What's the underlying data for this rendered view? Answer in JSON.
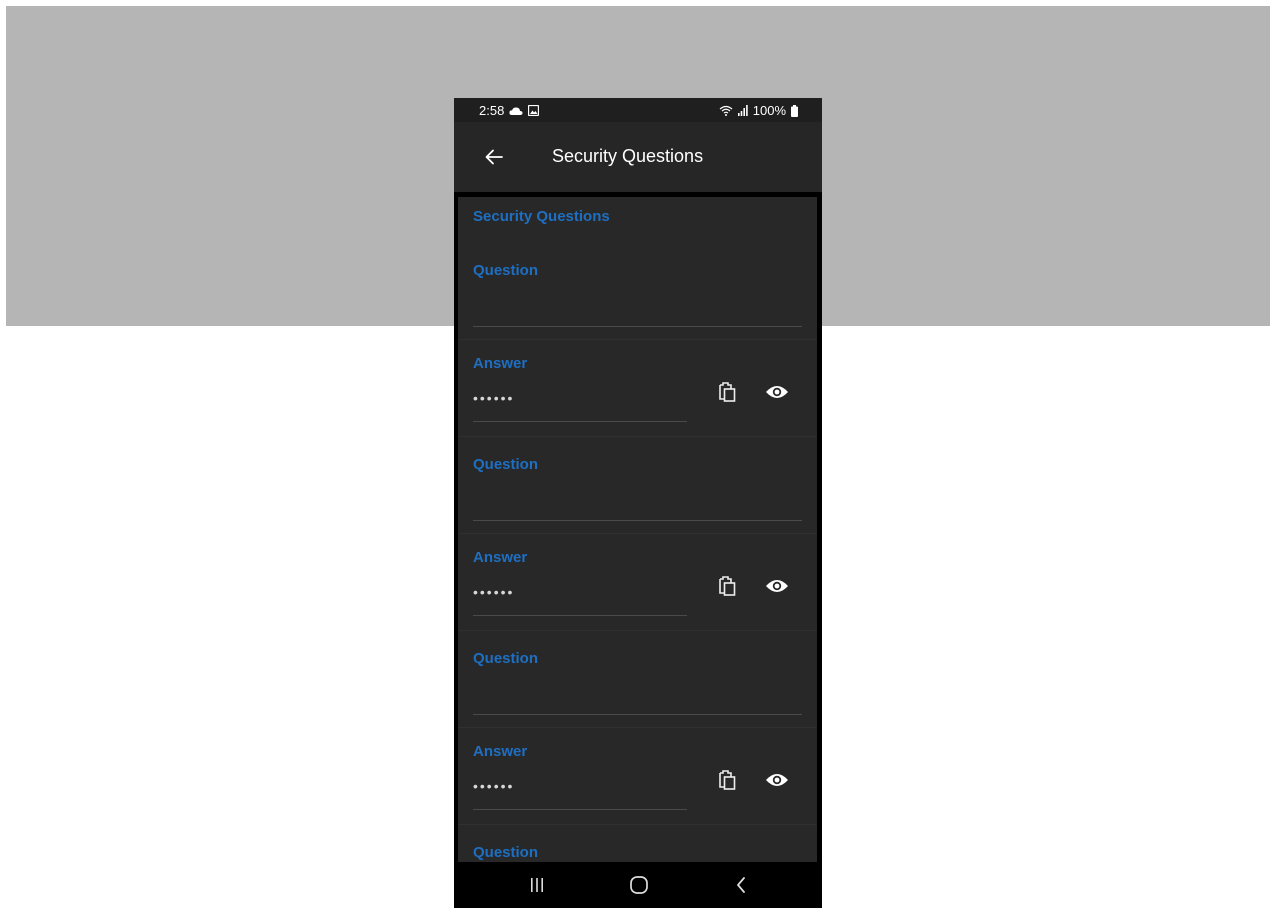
{
  "status_bar": {
    "time": "2:58",
    "battery": "100%",
    "icons": [
      "cloud-icon",
      "image-icon",
      "wifi-icon",
      "signal-icon",
      "battery-icon"
    ]
  },
  "app_bar": {
    "title": "Security Questions",
    "back_icon": "arrow-left-icon"
  },
  "card": {
    "section_title": "Security Questions",
    "rows": [
      {
        "question_label": "Question",
        "answer_label": "Answer",
        "answer_value": "••••••"
      },
      {
        "question_label": "Question",
        "answer_label": "Answer",
        "answer_value": "••••••"
      },
      {
        "question_label": "Question",
        "answer_label": "Answer",
        "answer_value": "••••••"
      },
      {
        "question_label": "Question"
      }
    ],
    "row_icons": [
      "clipboard-icon",
      "eye-icon"
    ]
  },
  "nav_bar": {
    "icons": [
      "recents-icon",
      "home-icon",
      "back-icon"
    ]
  },
  "colors": {
    "accent": "#1e6fc2",
    "appbar": "#262626",
    "card": "#282828",
    "backdrop": "#b5b5b5"
  }
}
